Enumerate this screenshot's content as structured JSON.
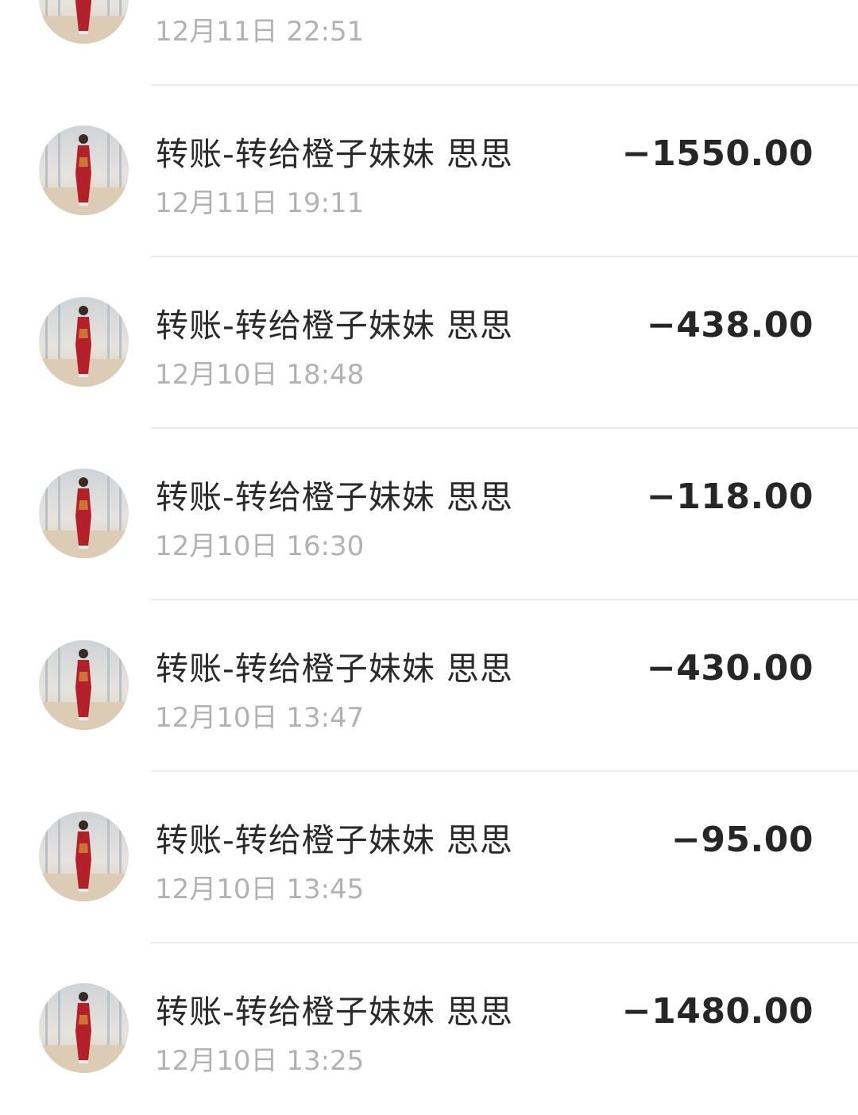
{
  "transactions": [
    {
      "title": "",
      "time": "12月11日 22:51",
      "amount": "",
      "avatar_icon": "contact-avatar-photo"
    },
    {
      "title": "转账-转给橙子妹妹 思思",
      "time": "12月11日 19:11",
      "amount": "−1550.00",
      "avatar_icon": "contact-avatar-photo"
    },
    {
      "title": "转账-转给橙子妹妹 思思",
      "time": "12月10日 18:48",
      "amount": "−438.00",
      "avatar_icon": "contact-avatar-photo"
    },
    {
      "title": "转账-转给橙子妹妹 思思",
      "time": "12月10日 16:30",
      "amount": "−118.00",
      "avatar_icon": "contact-avatar-photo"
    },
    {
      "title": "转账-转给橙子妹妹 思思",
      "time": "12月10日 13:47",
      "amount": "−430.00",
      "avatar_icon": "contact-avatar-photo"
    },
    {
      "title": "转账-转给橙子妹妹 思思",
      "time": "12月10日 13:45",
      "amount": "−95.00",
      "avatar_icon": "contact-avatar-photo"
    },
    {
      "title": "转账-转给橙子妹妹 思思",
      "time": "12月10日 13:25",
      "amount": "−1480.00",
      "avatar_icon": "contact-avatar-photo"
    }
  ],
  "colors": {
    "title": "#2a2a2a",
    "time": "#b2b2b2",
    "amount": "#262626",
    "divider": "#ececec",
    "avatar_dress": "#b3202a"
  }
}
